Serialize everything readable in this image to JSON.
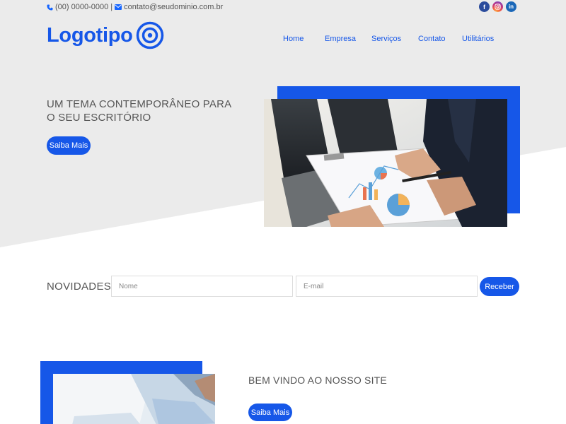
{
  "topbar": {
    "phone": "(00) 0000-0000",
    "separator": "|",
    "email": "contato@seudominio.com.br"
  },
  "social": {
    "facebook_glyph": "f",
    "linkedin_glyph": "in"
  },
  "logo": {
    "text": "Logotipo"
  },
  "nav": {
    "items": [
      "Home",
      "Empresa",
      "Serviços",
      "Contato",
      "Utilitários"
    ]
  },
  "hero": {
    "title": "UM TEMA CONTEMPORÂNEO PARA O SEU ESCRITÓRIO",
    "button_label": "Saiba Mais"
  },
  "newsletter": {
    "label": "NOVIDADES",
    "name_placeholder": "Nome",
    "email_placeholder": "E-mail",
    "button_label": "Receber"
  },
  "welcome": {
    "title": "BEM VINDO AO NOSSO SITE",
    "button_label": "Saiba Mais"
  },
  "colors": {
    "accent": "#1657e8",
    "hero_bg": "#ebebeb",
    "text": "#555555"
  }
}
